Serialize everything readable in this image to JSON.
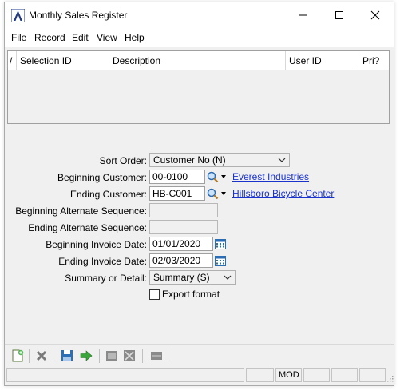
{
  "window": {
    "title": "Monthly Sales Register"
  },
  "menu": [
    "File",
    "Record",
    "Edit",
    "View",
    "Help"
  ],
  "grid": {
    "columns": [
      "Selection ID",
      "Description",
      "User ID",
      "Pri?"
    ],
    "row_marker": "/"
  },
  "form": {
    "sort_order": {
      "label": "Sort Order:",
      "value": "Customer No (N)"
    },
    "beginning_customer": {
      "label": "Beginning Customer:",
      "value": "00-0100",
      "lookup_name": "Everest Industries"
    },
    "ending_customer": {
      "label": "Ending Customer:",
      "value": "HB-C001",
      "lookup_name": "Hillsboro Bicycle Center"
    },
    "beginning_alt_seq": {
      "label": "Beginning Alternate Sequence:",
      "value": ""
    },
    "ending_alt_seq": {
      "label": "Ending Alternate Sequence:",
      "value": ""
    },
    "beginning_invoice_date": {
      "label": "Beginning Invoice Date:",
      "value": "01/01/2020"
    },
    "ending_invoice_date": {
      "label": "Ending Invoice Date:",
      "value": "02/03/2020"
    },
    "summary_or_detail": {
      "label": "Summary or Detail:",
      "value": "Summary (S)"
    },
    "export_format": {
      "label": "Export format",
      "checked": false
    }
  },
  "statusbar": {
    "panels": [
      "",
      "",
      "MOD",
      "",
      "",
      ""
    ]
  },
  "colors": {
    "link": "#1a33cc",
    "accent": "#0078d7"
  }
}
